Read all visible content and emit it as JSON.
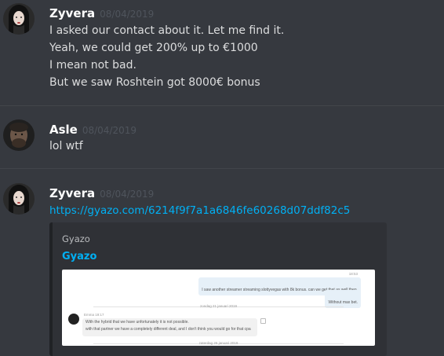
{
  "messages": [
    {
      "username": "Zyvera",
      "timestamp": "08/04/2019",
      "lines": [
        "I asked our contact about it. Let me find it.",
        "Yeah, we could get 200% up to €1000",
        "I mean not bad.",
        "But we saw Roshtein got 8000€ bonus"
      ]
    },
    {
      "username": "Asle",
      "timestamp": "08/04/2019",
      "lines": [
        "lol wtf"
      ]
    },
    {
      "username": "Zyvera",
      "timestamp": "08/04/2019",
      "link": "https://gyazo.com/6214f9f7a1a6846fe60268d07ddf82c5",
      "embed": {
        "provider": "Gyazo",
        "title": "Gyazo",
        "screenshot": {
          "time_right": "18:53",
          "msg_right_1": "I saw another streamer streaming slottyvegas with 8k bonus. can we get that as well then.",
          "msg_right_2": "Without max bet.",
          "date_sep_1": "zondag 21 januari 2019",
          "sender_name": "Emma 19:17",
          "msg_left_1": "With the hybrid that we have unfortunately it is not possible.",
          "msg_left_2": "with that partner we have a completely different deal, and I don't think you would go for that cpa",
          "date_sep_2": "zaterdag 26 januari 2019"
        }
      }
    }
  ],
  "colors": {
    "background": "#36393f",
    "username": "#ffffff",
    "timestamp": "#4f545c",
    "text": "#dcddde",
    "link": "#00b0f4",
    "embed_bg": "#2f3136"
  }
}
